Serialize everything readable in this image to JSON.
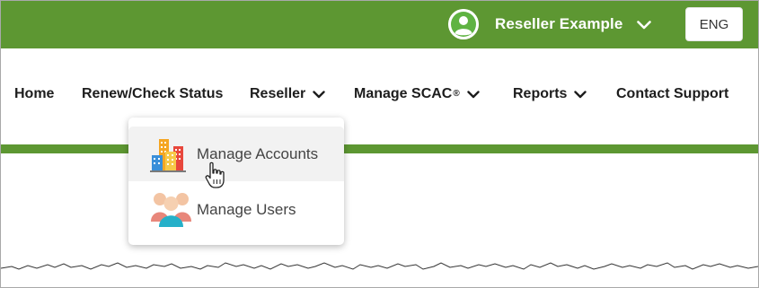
{
  "header": {
    "user_name": "Reseller Example",
    "language_button": "ENG",
    "bar_color": "#5d9732"
  },
  "nav": {
    "items": [
      {
        "label": "Home",
        "has_dropdown": false
      },
      {
        "label": "Renew/Check Status",
        "has_dropdown": false
      },
      {
        "label": "Reseller",
        "has_dropdown": true
      },
      {
        "label": "Manage SCAC",
        "superscript": "®",
        "has_dropdown": true
      },
      {
        "label": "Reports",
        "has_dropdown": true
      },
      {
        "label": "Contact Support",
        "has_dropdown": false
      }
    ]
  },
  "dropdown": {
    "items": [
      {
        "label": "Manage Accounts",
        "icon": "buildings-icon",
        "hovered": true
      },
      {
        "label": "Manage Users",
        "icon": "users-group-icon",
        "hovered": false
      }
    ]
  },
  "icons": {
    "avatar": "user-avatar-icon",
    "chevron": "chevron-down-icon",
    "cursor": "hand-pointer-cursor-icon"
  }
}
